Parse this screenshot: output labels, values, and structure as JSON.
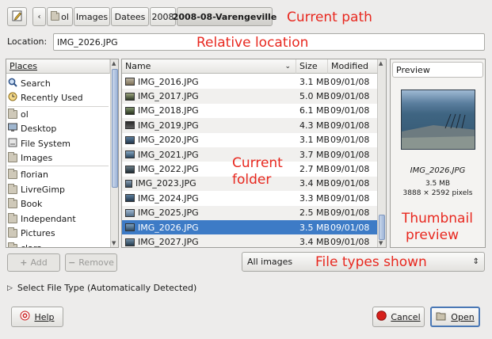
{
  "toolbar": {
    "edit_icon": "pencil-icon",
    "back_icon": "left-arrow-icon",
    "breadcrumb": [
      "ol",
      "Images",
      "Datees",
      "2008",
      "2008-08-Varengeville"
    ]
  },
  "location": {
    "label": "Location:",
    "value": "IMG_2026.JPG"
  },
  "places": {
    "header": "Places",
    "items": [
      {
        "label": "Search",
        "icon": "search-icon"
      },
      {
        "label": "Recently Used",
        "icon": "clock-icon"
      },
      {
        "label": "ol",
        "icon": "home-folder-icon"
      },
      {
        "label": "Desktop",
        "icon": "desktop-icon"
      },
      {
        "label": "File System",
        "icon": "drive-icon"
      },
      {
        "label": "Images",
        "icon": "folder-icon"
      },
      {
        "label": "florian",
        "icon": "folder-icon"
      },
      {
        "label": "LivreGimp",
        "icon": "folder-icon"
      },
      {
        "label": "Book",
        "icon": "folder-icon"
      },
      {
        "label": "Independant",
        "icon": "folder-icon"
      },
      {
        "label": "Pictures",
        "icon": "folder-icon"
      },
      {
        "label": "clara",
        "icon": "folder-icon"
      }
    ]
  },
  "files": {
    "columns": {
      "name": "Name",
      "size": "Size",
      "modified": "Modified"
    },
    "rows": [
      {
        "name": "IMG_2016.JPG",
        "size": "3.1 MB",
        "modified": "09/01/08"
      },
      {
        "name": "IMG_2017.JPG",
        "size": "5.0 MB",
        "modified": "09/01/08"
      },
      {
        "name": "IMG_2018.JPG",
        "size": "6.1 MB",
        "modified": "09/01/08"
      },
      {
        "name": "IMG_2019.JPG",
        "size": "4.3 MB",
        "modified": "09/01/08"
      },
      {
        "name": "IMG_2020.JPG",
        "size": "3.1 MB",
        "modified": "09/01/08"
      },
      {
        "name": "IMG_2021.JPG",
        "size": "3.7 MB",
        "modified": "09/01/08"
      },
      {
        "name": "IMG_2022.JPG",
        "size": "2.7 MB",
        "modified": "09/01/08"
      },
      {
        "name": "IMG_2023.JPG",
        "size": "3.4 MB",
        "modified": "09/01/08"
      },
      {
        "name": "IMG_2024.JPG",
        "size": "3.3 MB",
        "modified": "09/01/08"
      },
      {
        "name": "IMG_2025.JPG",
        "size": "2.5 MB",
        "modified": "09/01/08"
      },
      {
        "name": "IMG_2026.JPG",
        "size": "3.5 MB",
        "modified": "09/01/08",
        "selected": true
      },
      {
        "name": "IMG_2027.JPG",
        "size": "3.4 MB",
        "modified": "09/01/08"
      }
    ]
  },
  "preview": {
    "label": "Preview",
    "filename": "IMG_2026.JPG",
    "size": "3.5 MB",
    "dimensions": "3888 × 2592 pixels"
  },
  "buttons": {
    "add": "Add",
    "remove": "Remove",
    "help": "Help",
    "cancel": "Cancel",
    "open": "Open"
  },
  "filter": {
    "value": "All images"
  },
  "file_type": {
    "label": "Select File Type (Automatically Detected)"
  },
  "annotations": {
    "current_path": "Current path",
    "relative_location": "Relative location",
    "current_folder_1": "Current",
    "current_folder_2": "folder",
    "thumbnail_1": "Thumbnail",
    "thumbnail_2": "preview",
    "file_types": "File types shown"
  },
  "colors": {
    "selection": "#3d7bc6",
    "annotation": "#e8281f"
  }
}
